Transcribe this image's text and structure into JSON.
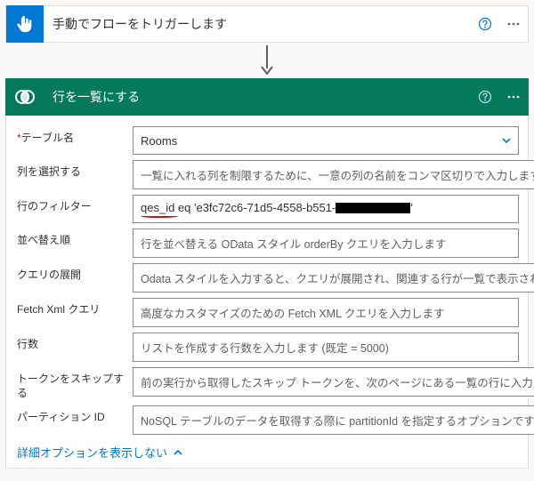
{
  "trigger": {
    "title": "手動でフローをトリガーします"
  },
  "action": {
    "title": "行を一覧にする"
  },
  "fields": {
    "tableName": {
      "label": "テーブル名",
      "value": "Rooms"
    },
    "selectColumns": {
      "label": "列を選択する",
      "placeholder": "一覧に入れる列を制限するために、一意の列の名前をコンマ区切りで入力します"
    },
    "filterRows": {
      "label": "行のフィルター",
      "prefix": "qes_id eq 'e3fc72c6-71d5-4558-b551-",
      "suffix": "'"
    },
    "sortBy": {
      "label": "並べ替え順",
      "placeholder": "行を並べ替える OData スタイル orderBy クエリを入力します"
    },
    "expandQuery": {
      "label": "クエリの展開",
      "placeholder": "Odata スタイルを入力すると、クエリが展開され、関連する行が一覧で表示されます"
    },
    "fetchXml": {
      "label": "Fetch Xml クエリ",
      "placeholder": "高度なカスタマイズのための Fetch XML クエリを入力します"
    },
    "rowCount": {
      "label": "行数",
      "placeholder": "リストを作成する行数を入力します (既定 = 5000)"
    },
    "skipToken": {
      "label": "トークンをスキップする",
      "placeholder": "前の実行から取得したスキップ トークンを、次のページにある一覧の行に入力します"
    },
    "partitionId": {
      "label": "パーティション ID",
      "placeholder": "NoSQL テーブルのデータを取得する際に partitionId を指定するオプションです"
    }
  },
  "toggleOptions": "詳細オプションを表示しない"
}
